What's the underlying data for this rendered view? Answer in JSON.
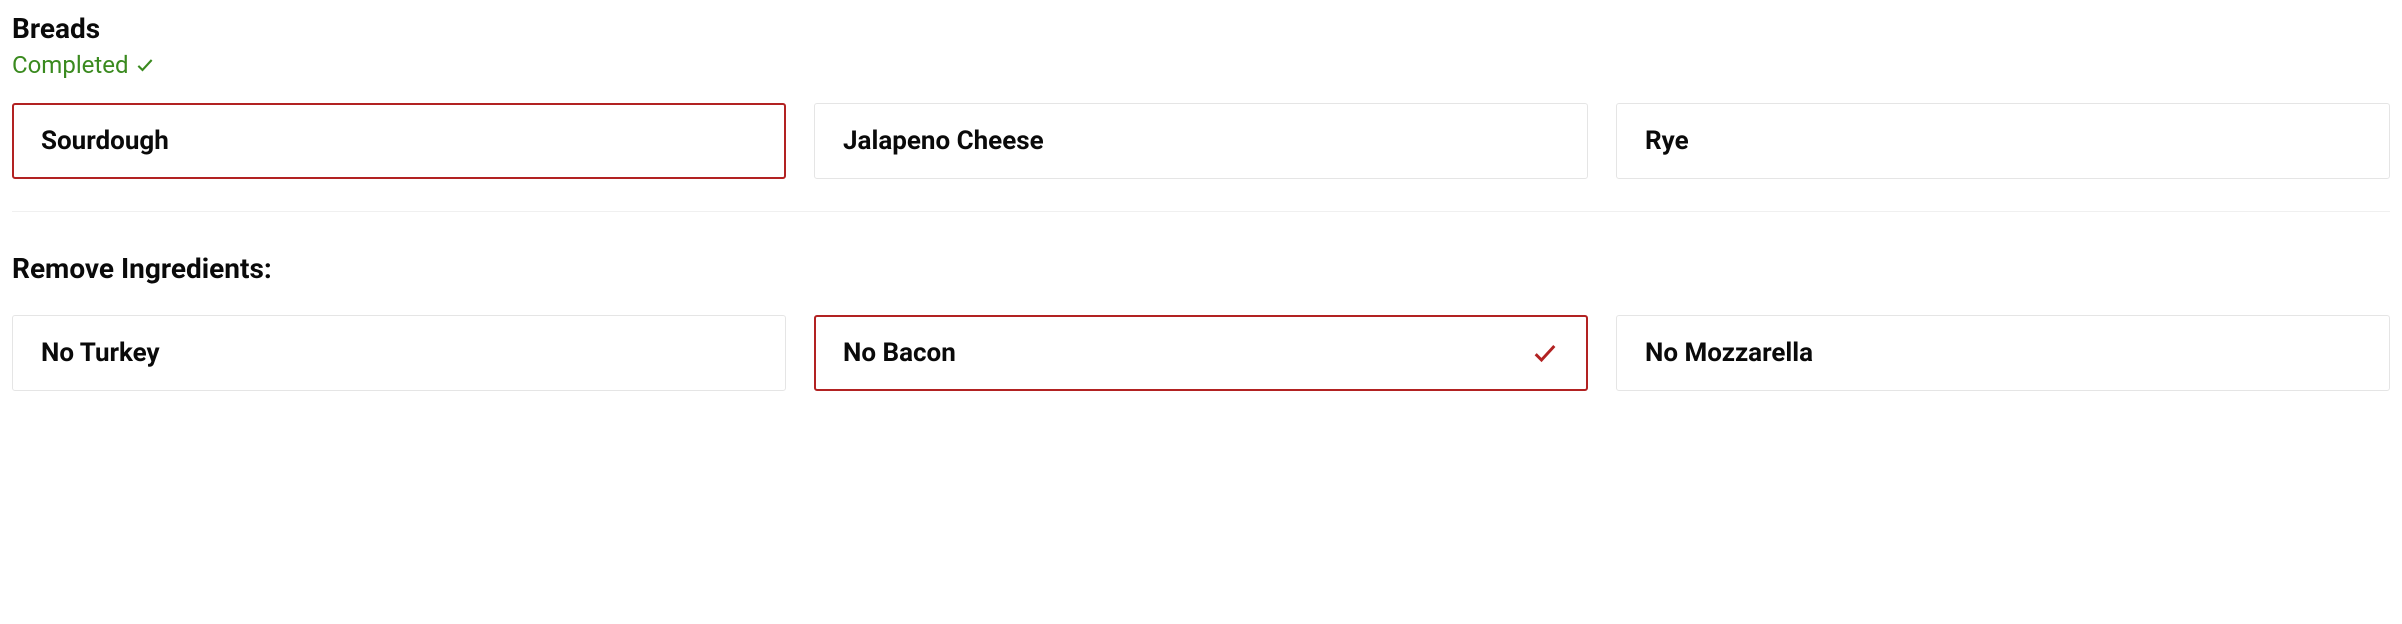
{
  "breads": {
    "title": "Breads",
    "status": "Completed",
    "options": [
      {
        "label": "Sourdough",
        "selected": true,
        "showCheck": false
      },
      {
        "label": "Jalapeno Cheese",
        "selected": false,
        "showCheck": false
      },
      {
        "label": "Rye",
        "selected": false,
        "showCheck": false
      }
    ]
  },
  "remove": {
    "title": "Remove Ingredients:",
    "options": [
      {
        "label": "No Turkey",
        "selected": false,
        "showCheck": false
      },
      {
        "label": "No Bacon",
        "selected": true,
        "showCheck": true
      },
      {
        "label": "No Mozzarella",
        "selected": false,
        "showCheck": false
      }
    ]
  }
}
